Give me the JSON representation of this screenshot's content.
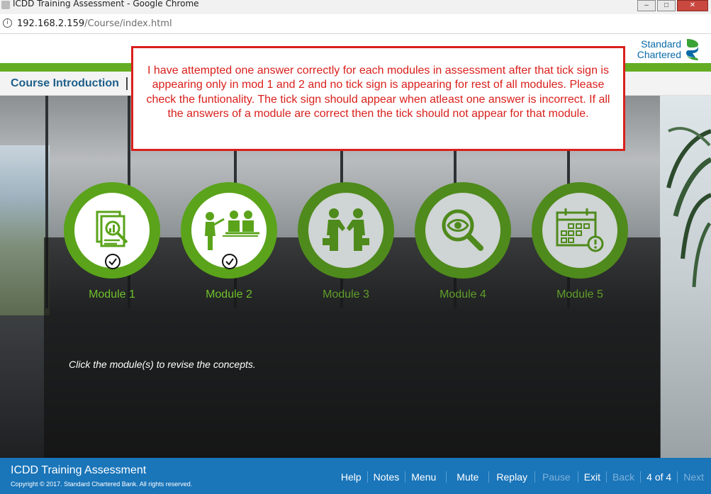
{
  "browser": {
    "window_title": "ICDD Training Assessment - Google Chrome",
    "url_host": "192.168.2.159",
    "url_path": "/Course/index.html"
  },
  "header": {
    "logo_line1": "Standard",
    "logo_line2": "Chartered",
    "course_title": "Course Introduction"
  },
  "annotation": {
    "text": "I have attempted one answer correctly for each modules in assessment after that tick sign is appearing only in mod 1 and 2 and no tick sign is appearing for rest of all modules. Please check the funtionality. The tick sign should appear when atleast one answer is incorrect. If all the answers of a module are correct then the tick should not appear for that module."
  },
  "modules": [
    {
      "label": "Module 1",
      "icon": "report-search-icon",
      "completed": true
    },
    {
      "label": "Module 2",
      "icon": "meeting-icon",
      "completed": true
    },
    {
      "label": "Module 3",
      "icon": "handshake-icon",
      "completed": false
    },
    {
      "label": "Module 4",
      "icon": "magnifier-eye-icon",
      "completed": false
    },
    {
      "label": "Module 5",
      "icon": "calendar-alert-icon",
      "completed": false
    }
  ],
  "instruction": "Click the module(s) to revise the concepts.",
  "footer": {
    "title": "ICDD Training Assessment",
    "copyright": "Copyright © 2017. Standard Chartered Bank. All rights reserved.",
    "help": "Help",
    "notes": "Notes",
    "menu": "Menu",
    "mute": "Mute",
    "replay": "Replay",
    "pause": "Pause",
    "exit": "Exit",
    "back": "Back",
    "page": "4 of 4",
    "next": "Next"
  },
  "colors": {
    "accent_green": "#64ad22",
    "footer_blue": "#1a75b9",
    "annotation_red": "#d9201c",
    "brand_blue": "#0a6aa8"
  }
}
